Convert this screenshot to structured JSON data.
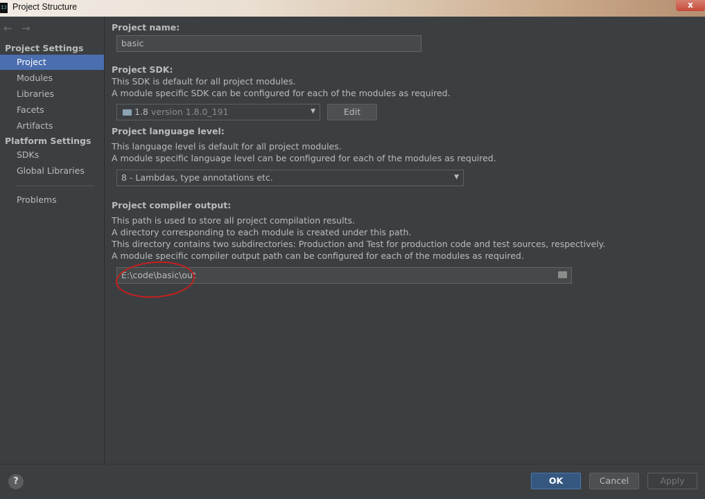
{
  "window": {
    "title": "Project Structure",
    "close_label": "x"
  },
  "sidebar": {
    "back_arrow": "←",
    "forward_arrow": "→",
    "project_settings_header": "Project Settings",
    "project_settings_items": [
      "Project",
      "Modules",
      "Libraries",
      "Facets",
      "Artifacts"
    ],
    "platform_settings_header": "Platform Settings",
    "platform_settings_items": [
      "SDKs",
      "Global Libraries"
    ],
    "problems_item": "Problems",
    "selected": "Project"
  },
  "project": {
    "name_label": "Project name:",
    "name_value": "basic",
    "sdk_label": "Project SDK:",
    "sdk_desc1": "This SDK is default for all project modules.",
    "sdk_desc2": "A module specific SDK can be configured for each of the modules as required.",
    "sdk_version": "1.8",
    "sdk_version_detail": "version 1.8.0_191",
    "sdk_edit_button": "Edit",
    "lang_label": "Project language level:",
    "lang_desc1": "This language level is default for all project modules.",
    "lang_desc2": "A module specific language level can be configured for each of the modules as required.",
    "lang_value": "8 - Lambdas, type annotations etc.",
    "compiler_label": "Project compiler output:",
    "compiler_desc1": "This path is used to store all project compilation results.",
    "compiler_desc2": "A directory corresponding to each module is created under this path.",
    "compiler_desc3": "This directory contains two subdirectories: Production and Test for production code and test sources, respectively.",
    "compiler_desc4": "A module specific compiler output path can be configured for each of the modules as required.",
    "compiler_path": "E:\\code\\basic\\out"
  },
  "footer": {
    "help": "?",
    "ok": "OK",
    "cancel": "Cancel",
    "apply": "Apply"
  },
  "colors": {
    "background": "#3c3f41",
    "selection": "#4b6eaf",
    "ok_button": "#365880",
    "annotation": "#c81e1e"
  }
}
